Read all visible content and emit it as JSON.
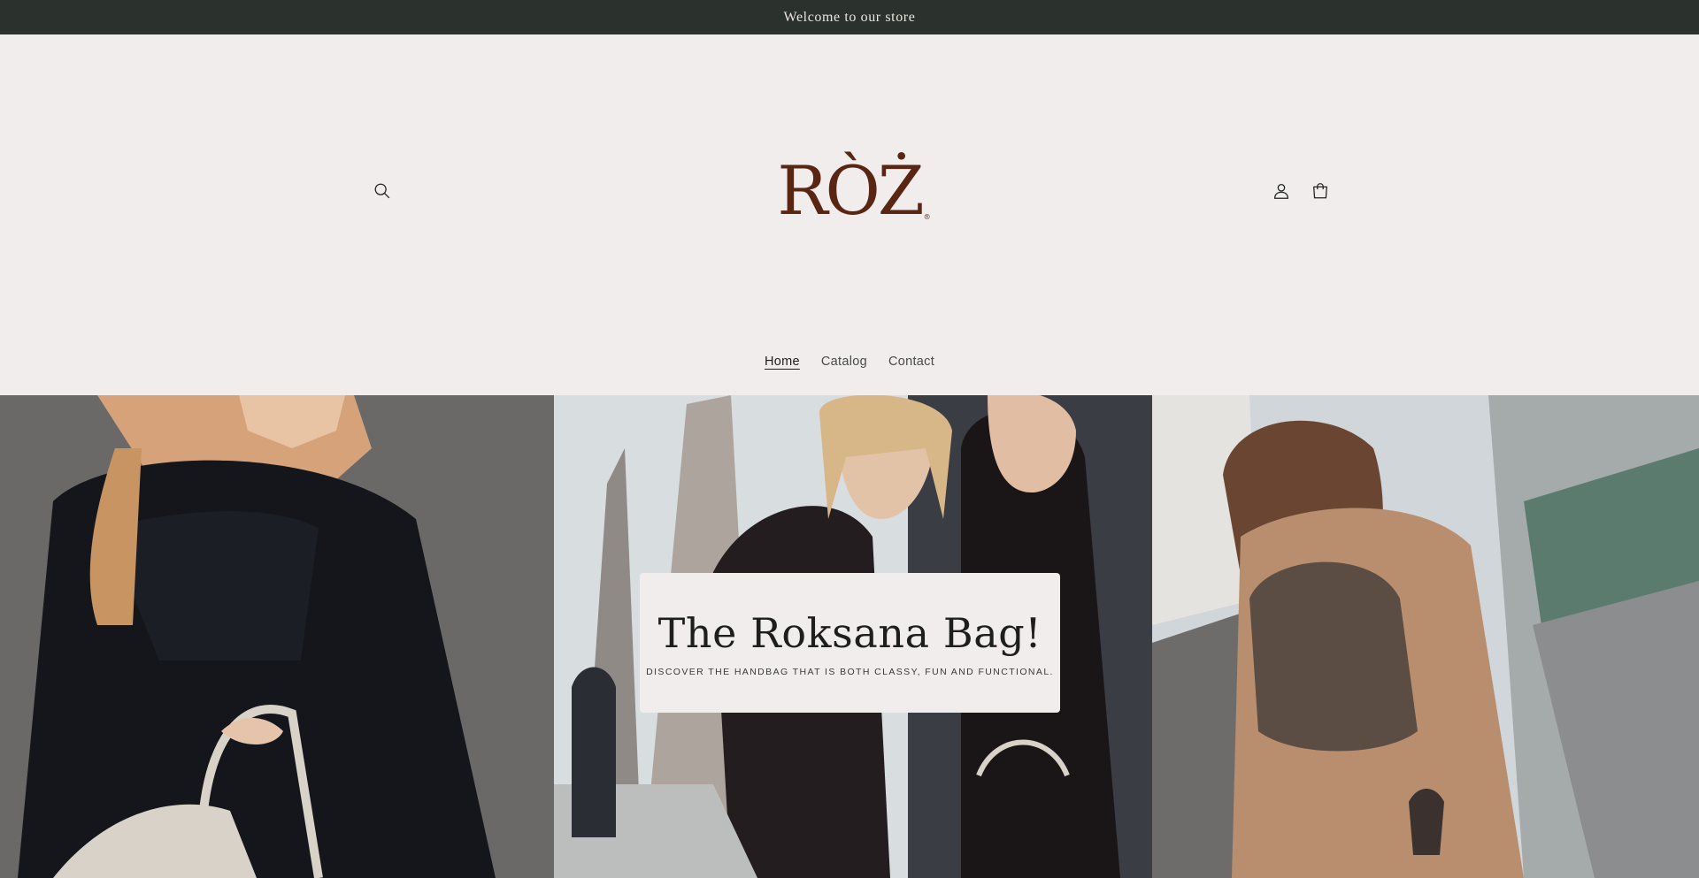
{
  "announcement": {
    "text": "Welcome to our store"
  },
  "header": {
    "logo_text": "RÒŻ",
    "logo_mark": "®",
    "icons": {
      "search": "search-icon",
      "account": "account-icon",
      "cart": "cart-icon"
    }
  },
  "nav": {
    "items": [
      {
        "label": "Home",
        "active": true
      },
      {
        "label": "Catalog",
        "active": false
      },
      {
        "label": "Contact",
        "active": false
      }
    ]
  },
  "hero": {
    "title": "The Roksana Bag!",
    "subtitle": "DISCOVER THE HANDBAG THAT IS BOTH CLASSY, FUN AND FUNCTIONAL."
  },
  "colors": {
    "announcement_bg": "#2b322e",
    "page_bg": "#f1eded",
    "logo": "#5a2614",
    "text": "#1e1e1e"
  }
}
